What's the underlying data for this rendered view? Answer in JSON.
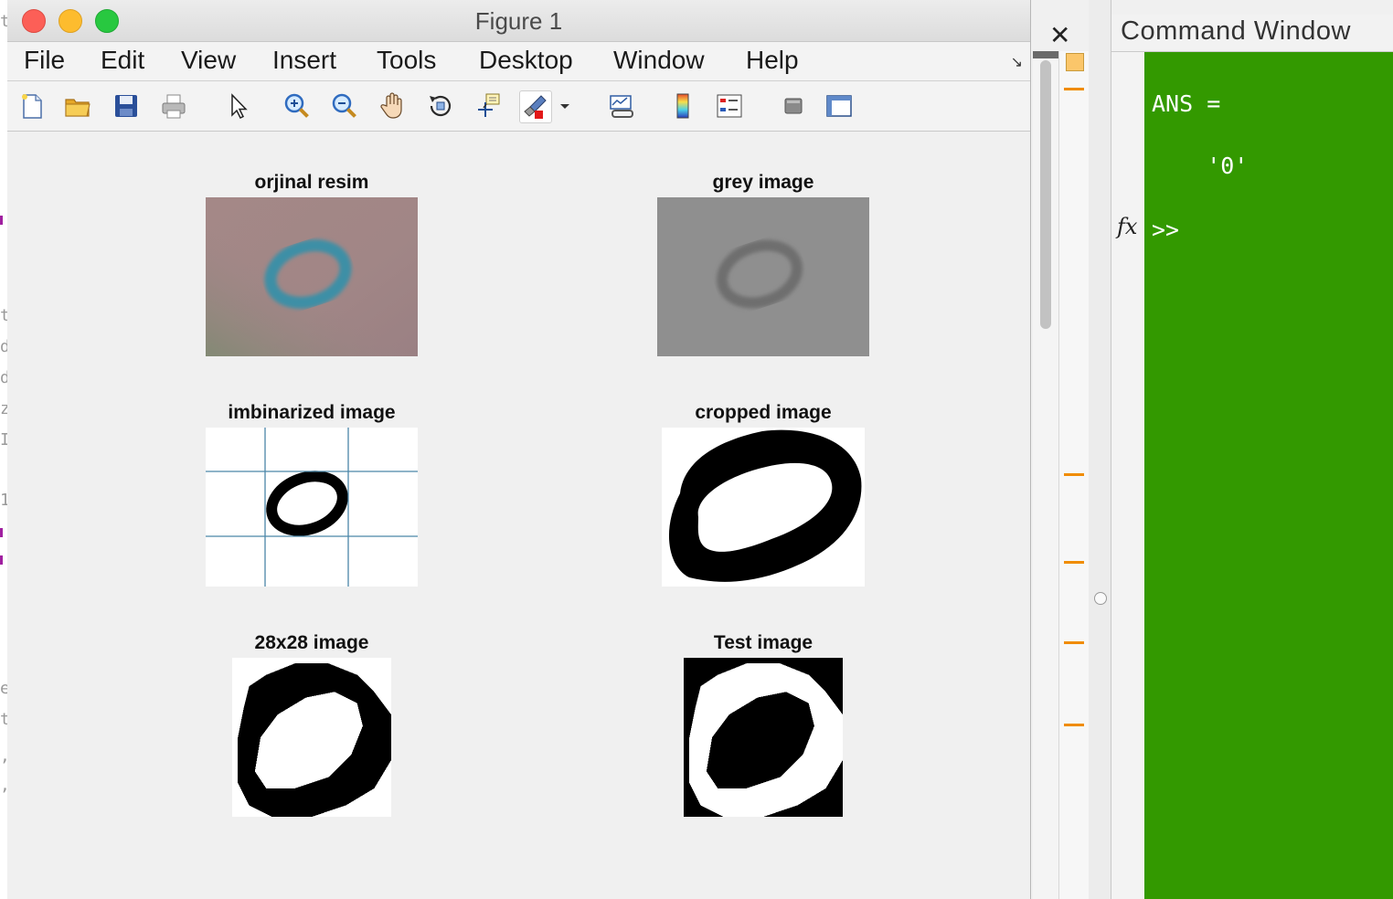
{
  "figure": {
    "window_title": "Figure 1",
    "menu": [
      "File",
      "Edit",
      "View",
      "Insert",
      "Tools",
      "Desktop",
      "Window",
      "Help"
    ],
    "menu_corner_glyph": "↘",
    "toolbar_icons": [
      "new-figure-icon",
      "open-file-icon",
      "save-icon",
      "print-icon",
      "edit-pointer-icon",
      "zoom-in-icon",
      "zoom-out-icon",
      "pan-hand-icon",
      "rotate-3d-icon",
      "data-cursor-icon",
      "brush-icon",
      "brush-dropdown-icon",
      "link-plot-icon",
      "colorbar-icon",
      "legend-icon",
      "hide-plot-tools-icon",
      "show-plot-tools-icon"
    ],
    "subplots": [
      {
        "title": "orjinal resim"
      },
      {
        "title": "grey image"
      },
      {
        "title": "imbinarized image"
      },
      {
        "title": "cropped image"
      },
      {
        "title": "28x28 image"
      },
      {
        "title": "Test image"
      }
    ]
  },
  "command_window": {
    "title": "Command Window",
    "lines": [
      "ANS =",
      "    '0'",
      ">>"
    ],
    "background_color": "#339900",
    "text_color": "#ffffff"
  },
  "editor_strip": {
    "marks": [
      "t",
      "t",
      "d",
      "d",
      "z",
      "I",
      "1",
      "e",
      "t",
      ",",
      ","
    ]
  },
  "colors": {
    "accent_annotation": "#f08c00",
    "close_button": "#fc5f57",
    "minimize_button": "#fdbc2e",
    "zoom_button": "#28c840"
  }
}
